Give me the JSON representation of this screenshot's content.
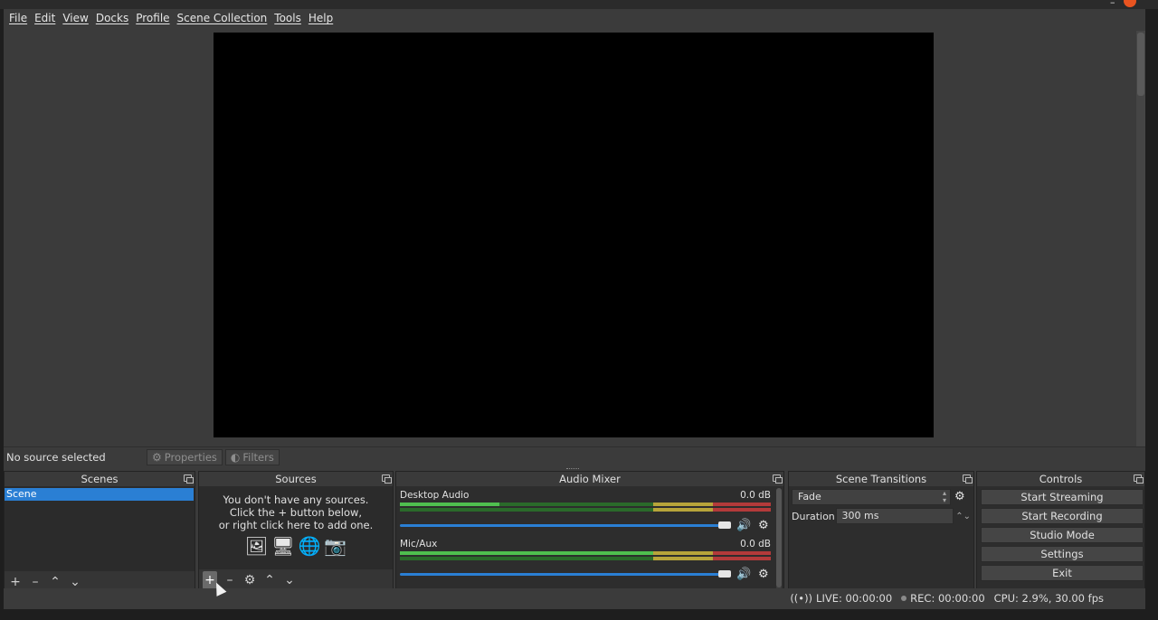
{
  "menu": [
    "File",
    "Edit",
    "View",
    "Docks",
    "Profile",
    "Scene Collection",
    "Tools",
    "Help"
  ],
  "context_bar": {
    "selection_label": "No source selected",
    "properties_label": "Properties",
    "filters_label": "Filters"
  },
  "docks": {
    "scenes": {
      "title": "Scenes",
      "items": [
        "Scene"
      ]
    },
    "sources": {
      "title": "Sources",
      "empty_line1": "You don't have any sources.",
      "empty_line2": "Click the + button below,",
      "empty_line3": "or right click here to add one."
    },
    "audio_mixer": {
      "title": "Audio Mixer",
      "channels": [
        {
          "name": "Desktop Audio",
          "level": "0.0 dB"
        },
        {
          "name": "Mic/Aux",
          "level": "0.0 dB"
        }
      ]
    },
    "scene_transitions": {
      "title": "Scene Transitions",
      "selected": "Fade",
      "duration_label": "Duration",
      "duration_value": "300 ms"
    },
    "controls": {
      "title": "Controls",
      "buttons": [
        "Start Streaming",
        "Start Recording",
        "Studio Mode",
        "Settings",
        "Exit"
      ]
    }
  },
  "status": {
    "live": "LIVE: 00:00:00",
    "rec": "REC: 00:00:00",
    "cpu": "CPU: 2.9%, 30.00 fps"
  },
  "colors": {
    "accent": "#2a7fd4",
    "meter_green": "#4fbf4f",
    "meter_yellow": "#b7a43a",
    "meter_red": "#b33a3a"
  }
}
